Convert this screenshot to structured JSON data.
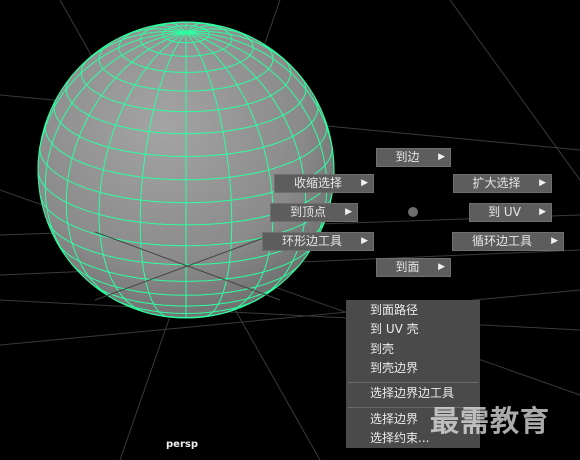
{
  "viewport": {
    "camera_label": "persp",
    "colors": {
      "background": "#000000",
      "grid": "#3a3a3a",
      "sphere": "#8e8e8e",
      "wireframe": "#2cffa0"
    }
  },
  "marking_menu": {
    "north": "到边",
    "south": "到面",
    "west": "到顶点",
    "east": "到 UV",
    "northwest": "收缩选择",
    "northeast": "扩大选择",
    "southwest": "环形边工具",
    "southeast": "循环边工具"
  },
  "menu_list": {
    "items": [
      "到面路径",
      "到 UV 壳",
      "到壳",
      "到壳边界",
      "选择边界边工具",
      "选择边界",
      "选择约束..."
    ]
  },
  "watermark": "最需教育"
}
